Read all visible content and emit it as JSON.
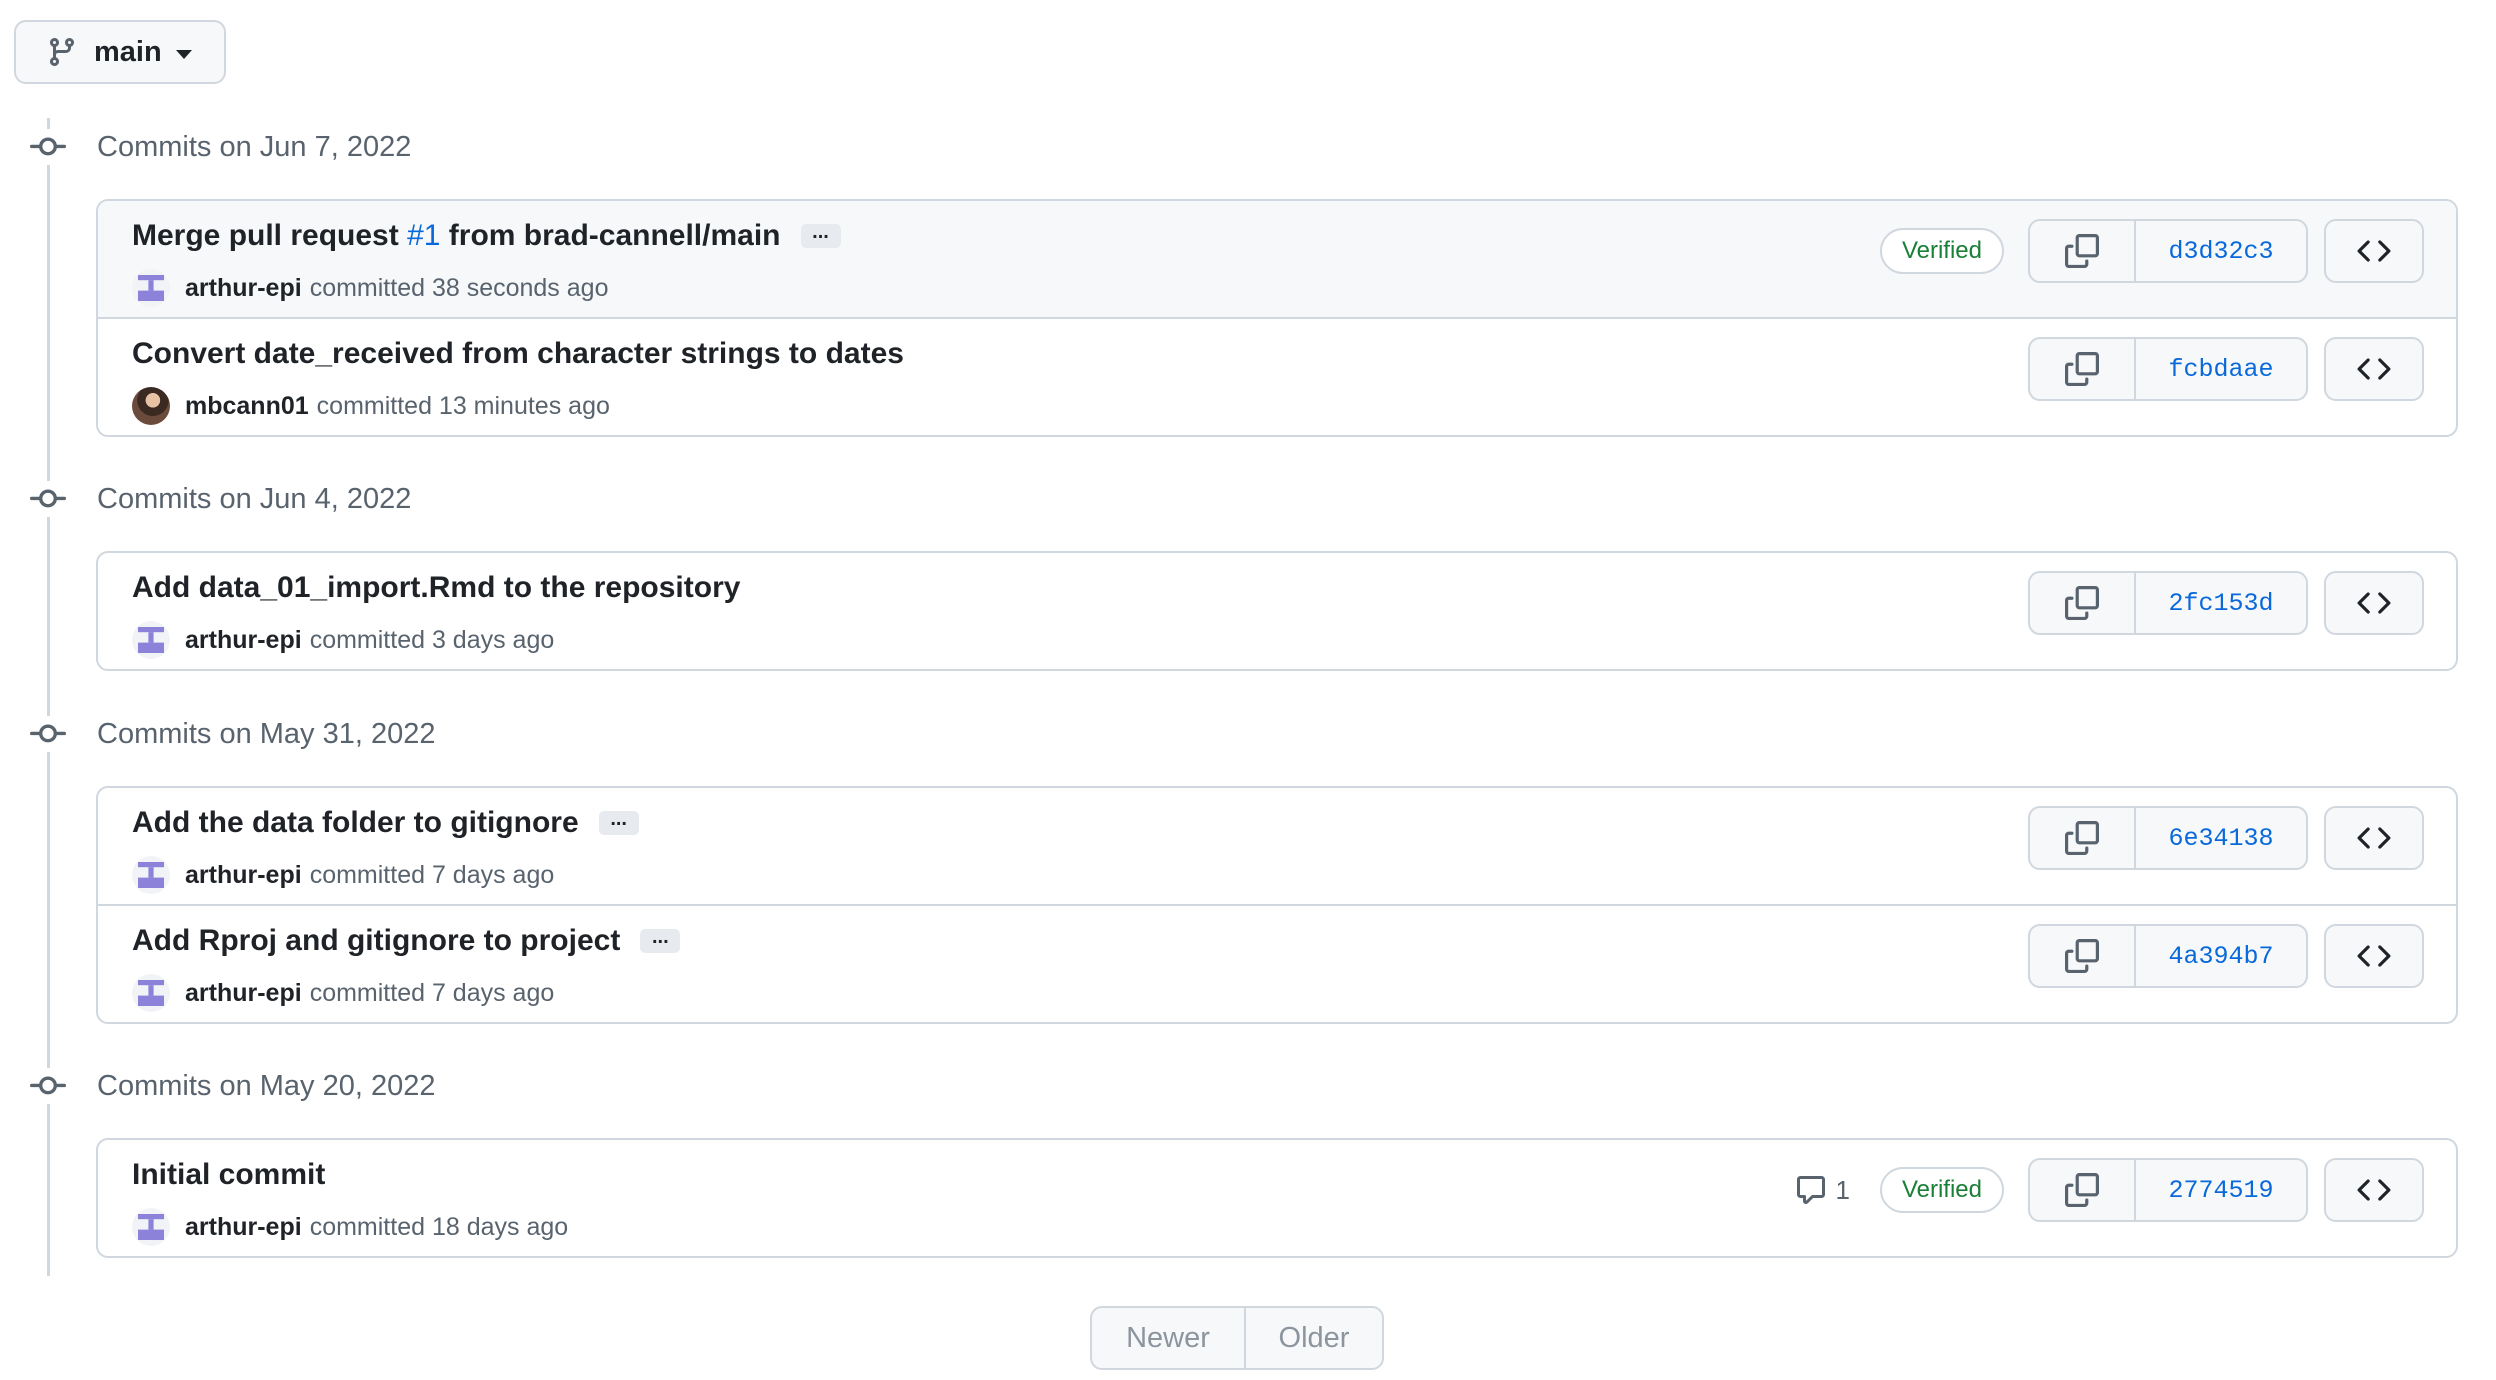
{
  "branch": {
    "name": "main",
    "icon": "git-branch-icon"
  },
  "pagination": {
    "newer": "Newer",
    "older": "Older"
  },
  "groups": [
    {
      "title": "Commits on Jun 7, 2022",
      "commits": [
        {
          "title_prefix": "Merge pull request ",
          "pr_number": "#1",
          "title_suffix": " from brad-cannell/main",
          "has_ellipsis": true,
          "author": "arthur-epi",
          "avatar": "identicon",
          "meta": "committed 38 seconds ago",
          "verified": "Verified",
          "sha": "d3d32c3"
        },
        {
          "title_prefix": "Convert date_received from character strings to dates",
          "has_ellipsis": false,
          "author": "mbcann01",
          "avatar": "photo",
          "meta": "committed 13 minutes ago",
          "sha": "fcbdaae"
        }
      ]
    },
    {
      "title": "Commits on Jun 4, 2022",
      "commits": [
        {
          "title_prefix": "Add data_01_import.Rmd to the repository",
          "has_ellipsis": false,
          "author": "arthur-epi",
          "avatar": "identicon",
          "meta": "committed 3 days ago",
          "sha": "2fc153d"
        }
      ]
    },
    {
      "title": "Commits on May 31, 2022",
      "commits": [
        {
          "title_prefix": "Add the data folder to gitignore",
          "has_ellipsis": true,
          "author": "arthur-epi",
          "avatar": "identicon",
          "meta": "committed 7 days ago",
          "sha": "6e34138"
        },
        {
          "title_prefix": "Add Rproj and gitignore to project",
          "has_ellipsis": true,
          "author": "arthur-epi",
          "avatar": "identicon",
          "meta": "committed 7 days ago",
          "sha": "4a394b7"
        }
      ]
    },
    {
      "title": "Commits on May 20, 2022",
      "commits": [
        {
          "title_prefix": "Initial commit",
          "has_ellipsis": false,
          "author": "arthur-epi",
          "avatar": "identicon",
          "meta": "committed 18 days ago",
          "comments": "1",
          "verified": "Verified",
          "sha": "2774519"
        }
      ]
    }
  ],
  "colors": {
    "link": "#0969da",
    "verified": "#1a7f37",
    "border": "#d0d7de",
    "muted": "#59636e"
  }
}
